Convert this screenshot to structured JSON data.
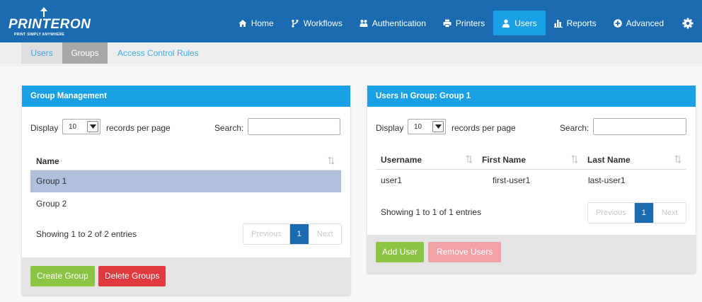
{
  "brand": {
    "name": "PRINTERON",
    "tagline": "PRINT SIMPLY ANYWHERE"
  },
  "nav": [
    {
      "label": "Home",
      "icon": "home-icon"
    },
    {
      "label": "Workflows",
      "icon": "workflow-icon"
    },
    {
      "label": "Authentication",
      "icon": "authentication-icon"
    },
    {
      "label": "Printers",
      "icon": "printer-icon"
    },
    {
      "label": "Users",
      "icon": "user-icon",
      "active": true
    },
    {
      "label": "Reports",
      "icon": "bar-chart-icon"
    },
    {
      "label": "Advanced",
      "icon": "plus-circle-icon"
    }
  ],
  "subtabs": [
    {
      "label": "Users"
    },
    {
      "label": "Groups",
      "active": true
    },
    {
      "label": "Access Control Rules"
    }
  ],
  "group_panel": {
    "title": "Group Management",
    "display_label": "Display",
    "page_size": "10",
    "records_label": "records per page",
    "search_label": "Search:",
    "search_value": "",
    "column": "Name",
    "rows": [
      {
        "name": "Group 1",
        "selected": true
      },
      {
        "name": "Group 2",
        "selected": false
      }
    ],
    "info": "Showing 1 to 2 of 2 entries",
    "pager": {
      "prev": "Previous",
      "page": "1",
      "next": "Next"
    },
    "buttons": {
      "create": "Create Group",
      "delete": "Delete Groups"
    }
  },
  "users_panel": {
    "title": "Users In Group: Group 1",
    "display_label": "Display",
    "page_size": "10",
    "records_label": "records per page",
    "search_label": "Search:",
    "search_value": "",
    "columns": {
      "username": "Username",
      "first": "First Name",
      "last": "Last Name"
    },
    "rows": [
      {
        "username": "user1",
        "first": "first-user1",
        "last": "last-user1"
      }
    ],
    "info": "Showing 1 to 1 of 1 entries",
    "pager": {
      "prev": "Previous",
      "page": "1",
      "next": "Next"
    },
    "buttons": {
      "add": "Add User",
      "remove": "Remove Users"
    }
  },
  "colors": {
    "topbar": "#1a6bb0",
    "accent": "#1aa0e6",
    "selected_row": "#afbfdc",
    "btn_green": "#8cc444",
    "btn_red": "#e0393f",
    "btn_pink_disabled": "#f2a2a6"
  }
}
